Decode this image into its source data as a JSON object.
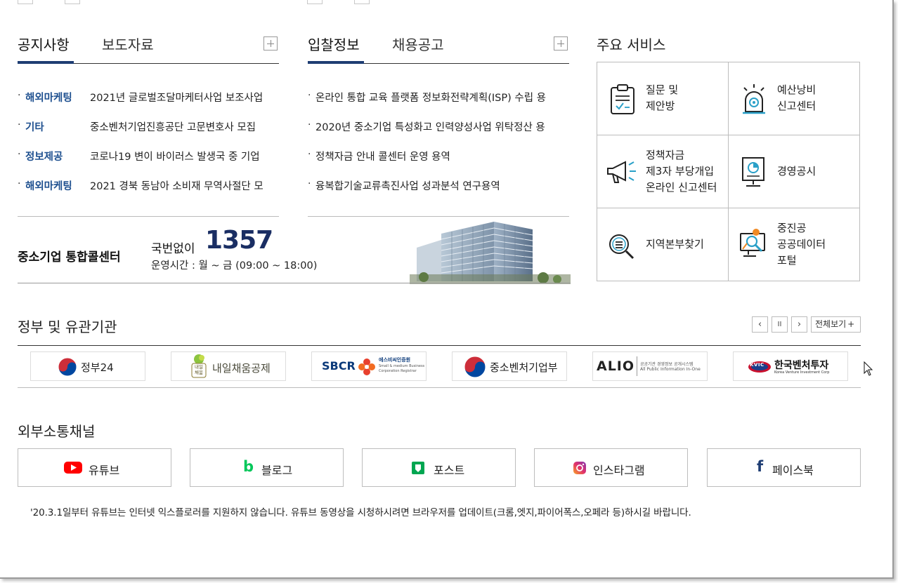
{
  "notice_panel": {
    "tabs": [
      {
        "label": "공지사항"
      },
      {
        "label": "보도자료"
      }
    ],
    "items": [
      {
        "category": "해외마케팅",
        "title": "2021년 글로벌조달마케터사업 보조사업"
      },
      {
        "category": "기타",
        "title": "중소벤처기업진흥공단 고문변호사 모집"
      },
      {
        "category": "정보제공",
        "title": "코로나19 변이 바이러스 발생국 중 기업"
      },
      {
        "category": "해외마케팅",
        "title": "2021 경북 동남아 소비재 무역사절단 모"
      }
    ]
  },
  "bid_panel": {
    "tabs": [
      {
        "label": "입찰정보"
      },
      {
        "label": "채용공고"
      }
    ],
    "items": [
      {
        "title": "온라인 통합 교육 플랫폼 정보화전략계획(ISP) 수립 용"
      },
      {
        "title": "2020년 중소기업 특성화고 인력양성사업 위탁정산 용"
      },
      {
        "title": "정책자금 안내 콜센터 운영 용역"
      },
      {
        "title": "융복합기술교류촉진사업 성과분석 연구용역"
      }
    ]
  },
  "callcenter": {
    "title": "중소기업 통합콜센터",
    "prefix": "국번없이",
    "number": "1357",
    "hours": "운영시간 : 월 ~ 금 (09:00 ~ 18:00)"
  },
  "services": {
    "title": "주요 서비스",
    "items": [
      {
        "label": "질문 및\n제안방",
        "icon": "clipboard-icon"
      },
      {
        "label": "예산낭비\n신고센터",
        "icon": "alarm-light-icon"
      },
      {
        "label": "정책자금\n제3자 부당개입\n온라인 신고센터",
        "icon": "megaphone-icon"
      },
      {
        "label": "경영공시",
        "icon": "presentation-board-icon"
      },
      {
        "label": "지역본부찾기",
        "icon": "magnifier-list-icon"
      },
      {
        "label": "중진공\n공공데이터\n포털",
        "icon": "data-monitor-icon"
      }
    ]
  },
  "agencies": {
    "title": "정부 및 유관기관",
    "view_all": "전체보기",
    "prev_glyph": "‹",
    "pause_glyph": "II",
    "next_glyph": "›",
    "logos": [
      {
        "name": "정부24"
      },
      {
        "name": "내일채움공제",
        "mark": "내일\n채움"
      },
      {
        "name": "SBCR",
        "sub1": "에스비씨인증원",
        "sub2": "Small & medium Business",
        "sub3": "Corporation Registrar"
      },
      {
        "name": "중소벤처기업부"
      },
      {
        "name": "ALIO",
        "sub1": "공공기관 경영정보 공개시스템",
        "sub2": "All Public Information In-One"
      },
      {
        "name": "한국벤처투자",
        "mark": "KVIC",
        "sub1": "Korea Venture Investment Corp"
      }
    ]
  },
  "channels": {
    "title": "외부소통채널",
    "items": [
      {
        "label": "유튜브",
        "icon": "youtube-icon",
        "color": "#ff0000"
      },
      {
        "label": "블로그",
        "icon": "blog-icon",
        "color": "#03c75a"
      },
      {
        "label": "포스트",
        "icon": "post-icon",
        "color": "#00a651"
      },
      {
        "label": "인스타그램",
        "icon": "instagram-icon",
        "color": "#c13584"
      },
      {
        "label": "페이스북",
        "icon": "facebook-icon",
        "color": "#1e3d73"
      }
    ],
    "notice": "'20.3.1일부터 유튜브는 인터넷 익스플로러를 지원하지 않습니다. 유튜브 동영상을 시청하시려면 브라우저를 업데이트(크롬,엣지,파이어폭스,오페라 등)하시길 바랍니다."
  },
  "colors": {
    "accent": "#1e3d73",
    "category": "#1d4f8f",
    "callnumber": "#1a2e63"
  }
}
